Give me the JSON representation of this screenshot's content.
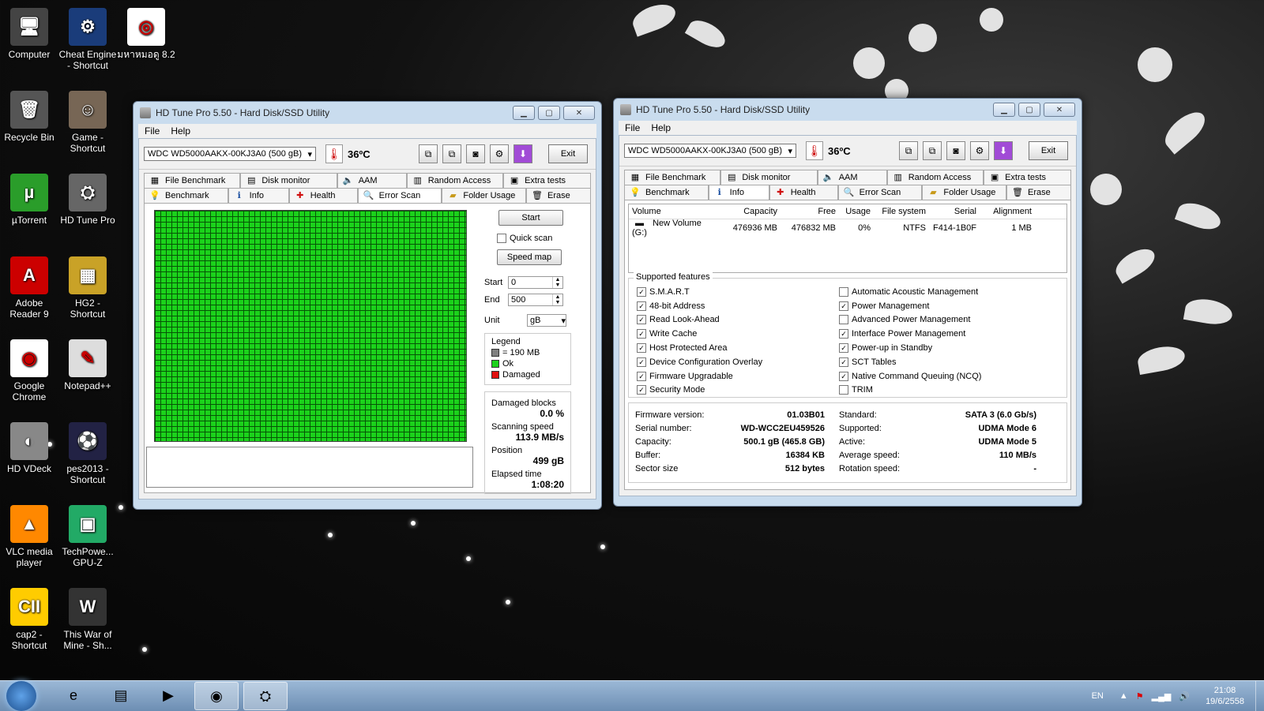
{
  "desktop": {
    "icons": [
      {
        "label": "Computer",
        "glyph": "🖥"
      },
      {
        "label": "Cheat Engine - Shortcut",
        "glyph": "⚙"
      },
      {
        "label": "มหาหมอดู 8.2",
        "glyph": "◎"
      },
      {
        "label": "Recycle Bin",
        "glyph": "🗑"
      },
      {
        "label": "Game - Shortcut",
        "glyph": "☺"
      },
      {
        "label": "µTorrent",
        "glyph": "µ"
      },
      {
        "label": "HD Tune Pro",
        "glyph": "⛭"
      },
      {
        "label": "Adobe Reader 9",
        "glyph": "A"
      },
      {
        "label": "HG2 - Shortcut",
        "glyph": "▦"
      },
      {
        "label": "Google Chrome",
        "glyph": "◉"
      },
      {
        "label": "Notepad++",
        "glyph": "✎"
      },
      {
        "label": "HD VDeck",
        "glyph": "◐"
      },
      {
        "label": "pes2013 - Shortcut",
        "glyph": "⚽"
      },
      {
        "label": "VLC media player",
        "glyph": "▲"
      },
      {
        "label": "TechPowe... GPU-Z",
        "glyph": "▣"
      },
      {
        "label": "cap2 - Shortcut",
        "glyph": "CII"
      },
      {
        "label": "This War of Mine - Sh...",
        "glyph": "W"
      }
    ]
  },
  "window_left": {
    "title": "HD Tune Pro 5.50 - Hard Disk/SSD Utility",
    "menu": [
      "File",
      "Help"
    ],
    "drive": "WDC WD5000AAKX-00KJ3A0 (500 gB)",
    "temperature": "36ºC",
    "exit_label": "Exit",
    "tabs_row1": [
      "File Benchmark",
      "Disk monitor",
      "AAM",
      "Random Access",
      "Extra tests"
    ],
    "tabs_row2": [
      "Benchmark",
      "Info",
      "Health",
      "Error Scan",
      "Folder Usage",
      "Erase"
    ],
    "active_tab": "Error Scan",
    "error_scan": {
      "start_button": "Start",
      "quick_scan_label": "Quick scan",
      "quick_scan_checked": false,
      "speed_map_button": "Speed map",
      "start_label": "Start",
      "start_value": "0",
      "end_label": "End",
      "end_value": "500",
      "unit_label": "Unit",
      "unit_value": "gB",
      "legend_title": "Legend",
      "legend": [
        {
          "label": "= 190 MB",
          "color": "#808080"
        },
        {
          "label": "Ok",
          "color": "#1bd21b"
        },
        {
          "label": "Damaged",
          "color": "#e01010"
        }
      ],
      "damaged_blocks_label": "Damaged blocks",
      "damaged_blocks_value": "0.0 %",
      "scanning_speed_label": "Scanning speed",
      "scanning_speed_value": "113.9 MB/s",
      "position_label": "Position",
      "position_value": "499 gB",
      "elapsed_label": "Elapsed time",
      "elapsed_value": "1:08:20"
    }
  },
  "window_right": {
    "title": "HD Tune Pro 5.50 - Hard Disk/SSD Utility",
    "menu": [
      "File",
      "Help"
    ],
    "drive": "WDC WD5000AAKX-00KJ3A0 (500 gB)",
    "temperature": "36ºC",
    "exit_label": "Exit",
    "tabs_row1": [
      "File Benchmark",
      "Disk monitor",
      "AAM",
      "Random Access",
      "Extra tests"
    ],
    "tabs_row2": [
      "Benchmark",
      "Info",
      "Health",
      "Error Scan",
      "Folder Usage",
      "Erase"
    ],
    "active_tab": "Info",
    "volume_headers": [
      "Volume",
      "Capacity",
      "Free",
      "Usage",
      "File system",
      "Serial",
      "Alignment"
    ],
    "volume_row": [
      "New Volume (G:)",
      "476936 MB",
      "476832 MB",
      "0%",
      "NTFS",
      "F414-1B0F",
      "1 MB"
    ],
    "supported_features_title": "Supported features",
    "features_left": [
      {
        "label": "S.M.A.R.T",
        "checked": true
      },
      {
        "label": "48-bit Address",
        "checked": true
      },
      {
        "label": "Read Look-Ahead",
        "checked": true
      },
      {
        "label": "Write Cache",
        "checked": true
      },
      {
        "label": "Host Protected Area",
        "checked": true
      },
      {
        "label": "Device Configuration Overlay",
        "checked": true
      },
      {
        "label": "Firmware Upgradable",
        "checked": true
      },
      {
        "label": "Security Mode",
        "checked": true
      }
    ],
    "features_right": [
      {
        "label": "Automatic Acoustic Management",
        "checked": false
      },
      {
        "label": "Power Management",
        "checked": true
      },
      {
        "label": "Advanced Power Management",
        "checked": false
      },
      {
        "label": "Interface Power Management",
        "checked": true
      },
      {
        "label": "Power-up in Standby",
        "checked": true
      },
      {
        "label": "SCT Tables",
        "checked": true
      },
      {
        "label": "Native Command Queuing (NCQ)",
        "checked": true
      },
      {
        "label": "TRIM",
        "checked": false
      }
    ],
    "details_left": [
      {
        "label": "Firmware version:",
        "value": "01.03B01"
      },
      {
        "label": "Serial number:",
        "value": "WD-WCC2EU459526"
      },
      {
        "label": "Capacity:",
        "value": "500.1 gB (465.8 GB)"
      },
      {
        "label": "Buffer:",
        "value": "16384 KB"
      },
      {
        "label": "Sector size",
        "value": "512 bytes"
      }
    ],
    "details_right": [
      {
        "label": "Standard:",
        "value": "SATA 3 (6.0 Gb/s)"
      },
      {
        "label": "Supported:",
        "value": "UDMA Mode 6"
      },
      {
        "label": "Active:",
        "value": "UDMA Mode 5"
      },
      {
        "label": "Average speed:",
        "value": "110 MB/s"
      },
      {
        "label": "Rotation speed:",
        "value": "-"
      }
    ]
  },
  "taskbar": {
    "items": [
      {
        "name": "internet-explorer",
        "glyph": "e",
        "open": false
      },
      {
        "name": "file-explorer",
        "glyph": "▤",
        "open": false
      },
      {
        "name": "media-player",
        "glyph": "▶",
        "open": false
      },
      {
        "name": "chrome",
        "glyph": "◉",
        "open": true
      },
      {
        "name": "hd-tune",
        "glyph": "⛭",
        "open": true
      }
    ],
    "language": "EN",
    "time": "21:08",
    "date": "19/6/2558"
  }
}
